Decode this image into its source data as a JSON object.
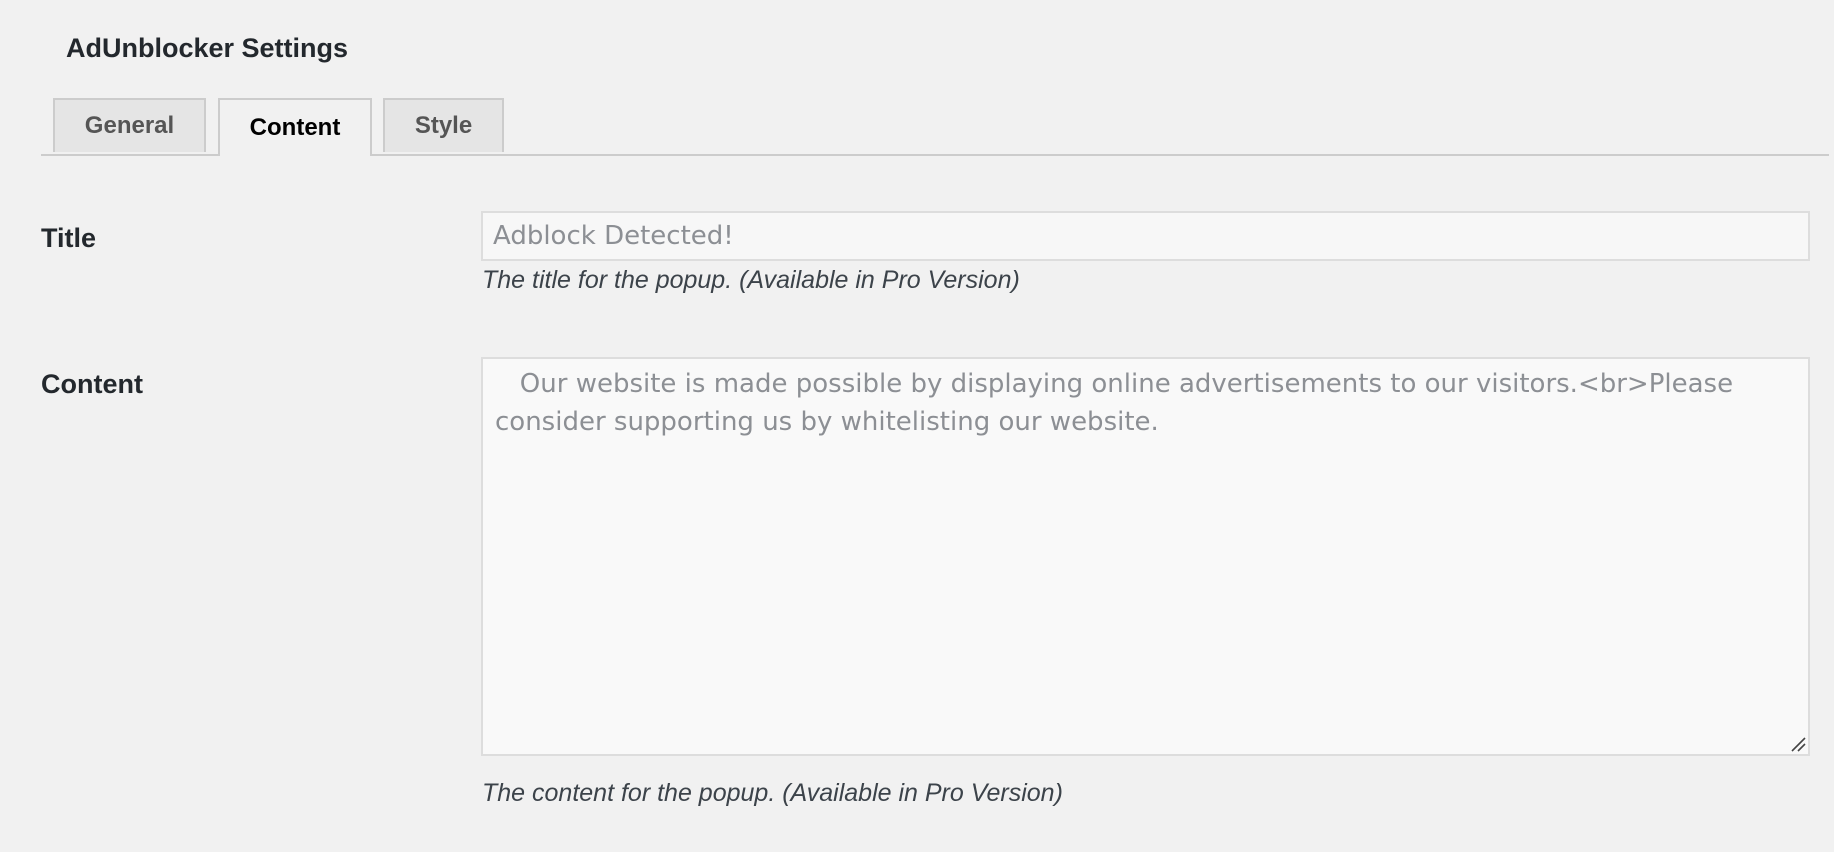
{
  "page": {
    "title": "AdUnblocker Settings"
  },
  "tabs": [
    {
      "label": "General",
      "active": false
    },
    {
      "label": "Content",
      "active": true
    },
    {
      "label": "Style",
      "active": false
    }
  ],
  "fields": {
    "title": {
      "label": "Title",
      "placeholder": "Adblock Detected!",
      "value": "",
      "description": "The title for the popup. (Available in Pro Version)"
    },
    "content": {
      "label": "Content",
      "value": "   Our website is made possible by displaying online advertisements to our visitors.<br>Please consider supporting us by whitelisting our website.",
      "description": "The content for the popup. (Available in Pro Version)"
    }
  },
  "colors": {
    "background": "#f1f1f1",
    "tab_inactive_bg": "#e5e5e5",
    "border": "#cccccc",
    "input_text": "#8c8f94"
  }
}
